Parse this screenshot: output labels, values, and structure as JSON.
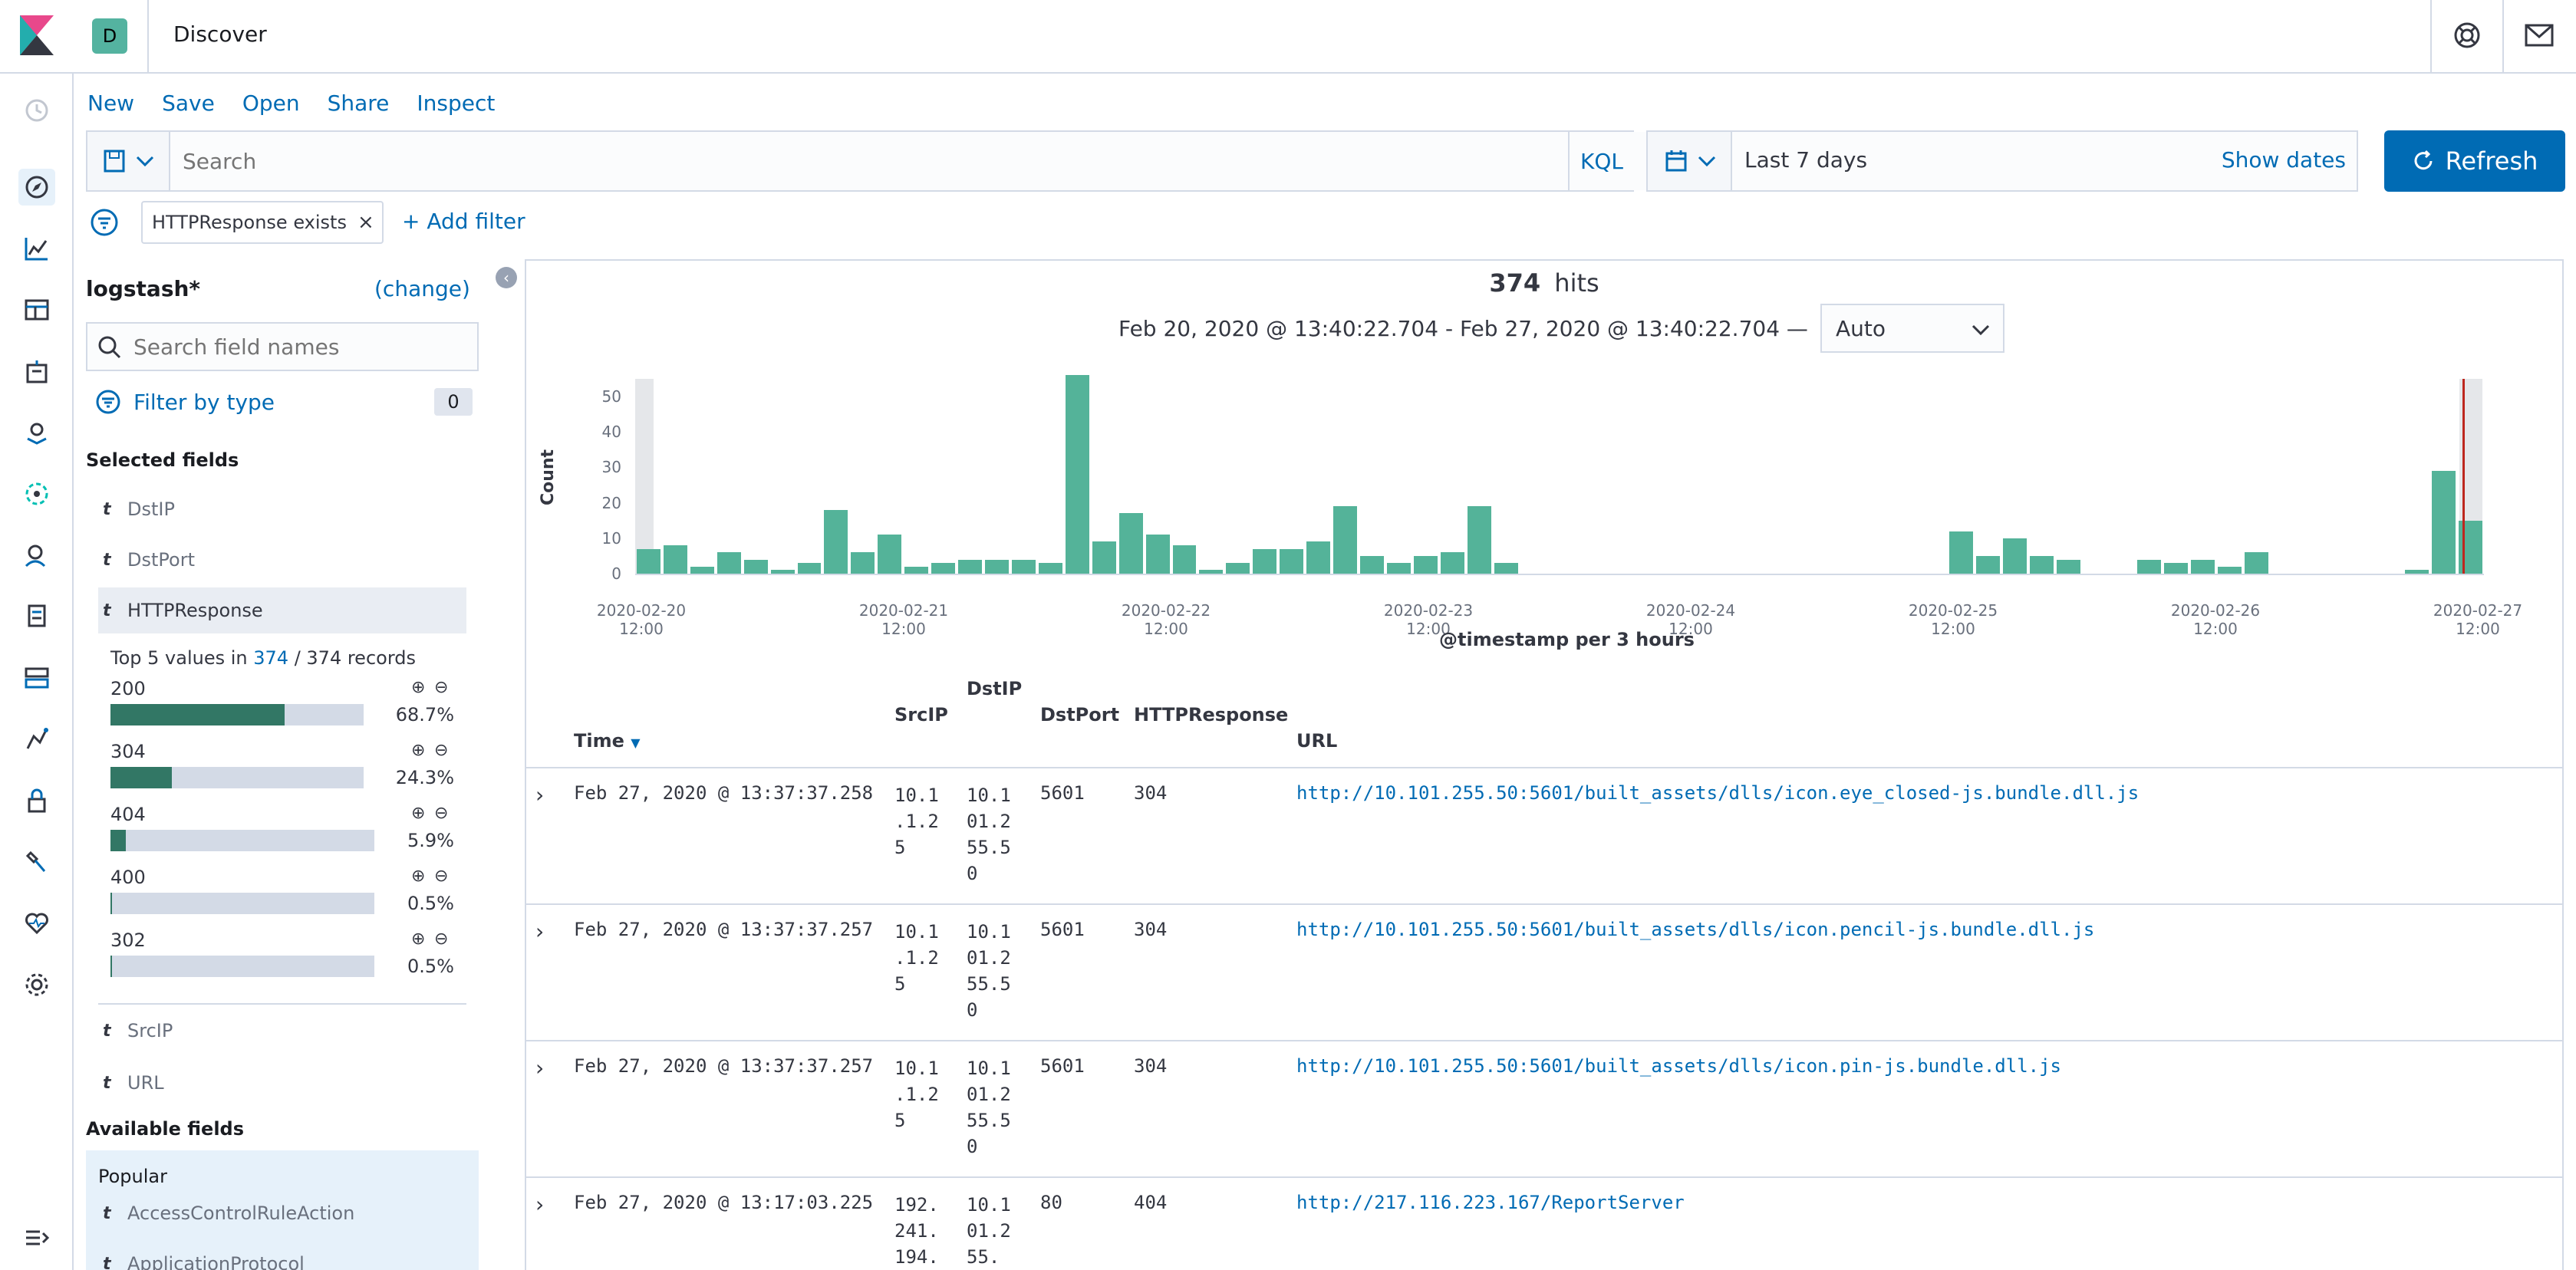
{
  "app": {
    "space_initial": "D",
    "page_title": "Discover"
  },
  "menu": [
    "New",
    "Save",
    "Open",
    "Share",
    "Inspect"
  ],
  "query": {
    "placeholder": "Search",
    "language": "KQL"
  },
  "time": {
    "range": "Last 7 days",
    "show_dates": "Show dates",
    "refresh": "Refresh"
  },
  "filter": {
    "pill": "HTTPResponse exists",
    "add": "+ Add filter"
  },
  "sidebar": {
    "index_pattern": "logstash*",
    "change": "(change)",
    "search_placeholder": "Search field names",
    "filter_by_type": "Filter by type",
    "filter_count": "0",
    "selected_title": "Selected fields",
    "selected": [
      "DstIP",
      "DstPort",
      "HTTPResponse",
      "SrcIP",
      "URL"
    ],
    "top5": {
      "prefix": "Top 5 values in",
      "count": "374",
      "suffix": "/ 374 records",
      "values": [
        {
          "label": "200",
          "pct": "68.7%",
          "frac": 0.687
        },
        {
          "label": "304",
          "pct": "24.3%",
          "frac": 0.243
        },
        {
          "label": "404",
          "pct": "5.9%",
          "frac": 0.059
        },
        {
          "label": "400",
          "pct": "0.5%",
          "frac": 0.005
        },
        {
          "label": "302",
          "pct": "0.5%",
          "frac": 0.005
        }
      ]
    },
    "available_title": "Available fields",
    "popular_title": "Popular",
    "popular": [
      "AccessControlRuleAction",
      "ApplicationProtocol"
    ]
  },
  "results": {
    "hits": "374",
    "hits_label": "hits",
    "range_text": "Feb 20, 2020 @ 13:40:22.704 - Feb 27, 2020 @ 13:40:22.704 —",
    "interval": "Auto"
  },
  "chart_data": {
    "type": "bar",
    "ylabel": "Count",
    "xlabel": "@timestamp per 3 hours",
    "ylim": [
      0,
      55
    ],
    "y_ticks": [
      "0",
      "10",
      "20",
      "30",
      "40",
      "50"
    ],
    "x_ticks": [
      "2020-02-20 12:00",
      "2020-02-21 12:00",
      "2020-02-22 12:00",
      "2020-02-23 12:00",
      "2020-02-24 12:00",
      "2020-02-25 12:00",
      "2020-02-26 12:00",
      "2020-02-27 12:00"
    ],
    "values": [
      7,
      8,
      2,
      6,
      4,
      1,
      3,
      18,
      6,
      11,
      2,
      3,
      4,
      4,
      4,
      3,
      56,
      9,
      17,
      11,
      8,
      1,
      3,
      7,
      7,
      9,
      19,
      5,
      3,
      5,
      6,
      19,
      3,
      0,
      0,
      0,
      0,
      0,
      0,
      0,
      0,
      0,
      0,
      0,
      0,
      0,
      0,
      0,
      0,
      12,
      5,
      10,
      5,
      4,
      0,
      0,
      4,
      3,
      4,
      2,
      6,
      0,
      0,
      0,
      0,
      0,
      1,
      29,
      15
    ],
    "grid": false
  },
  "table": {
    "headers": {
      "time": "Time",
      "src": "SrcIP",
      "dst": "DstIP",
      "port": "DstPort",
      "resp": "HTTPResponse",
      "url": "URL"
    },
    "rows": [
      {
        "time": "Feb 27, 2020 @ 13:37:37.258",
        "src": "10.1.1.25",
        "dst": "10.101.255.50",
        "port": "5601",
        "resp": "304",
        "url": "http://10.101.255.50:5601/built_assets/dlls/icon.eye_closed-js.bundle.dll.js"
      },
      {
        "time": "Feb 27, 2020 @ 13:37:37.257",
        "src": "10.1.1.25",
        "dst": "10.101.255.50",
        "port": "5601",
        "resp": "304",
        "url": "http://10.101.255.50:5601/built_assets/dlls/icon.pencil-js.bundle.dll.js"
      },
      {
        "time": "Feb 27, 2020 @ 13:37:37.257",
        "src": "10.1.1.25",
        "dst": "10.101.255.50",
        "port": "5601",
        "resp": "304",
        "url": "http://10.101.255.50:5601/built_assets/dlls/icon.pin-js.bundle.dll.js"
      },
      {
        "time": "Feb 27, 2020 @ 13:17:03.225",
        "src": "192.241.194.",
        "dst": "10.101.255.",
        "port": "80",
        "resp": "404",
        "url": "http://217.116.223.167/ReportServer"
      }
    ]
  },
  "colors": {
    "accent": "#006bb4",
    "bar": "#54b399",
    "logo": "#e8488b"
  }
}
